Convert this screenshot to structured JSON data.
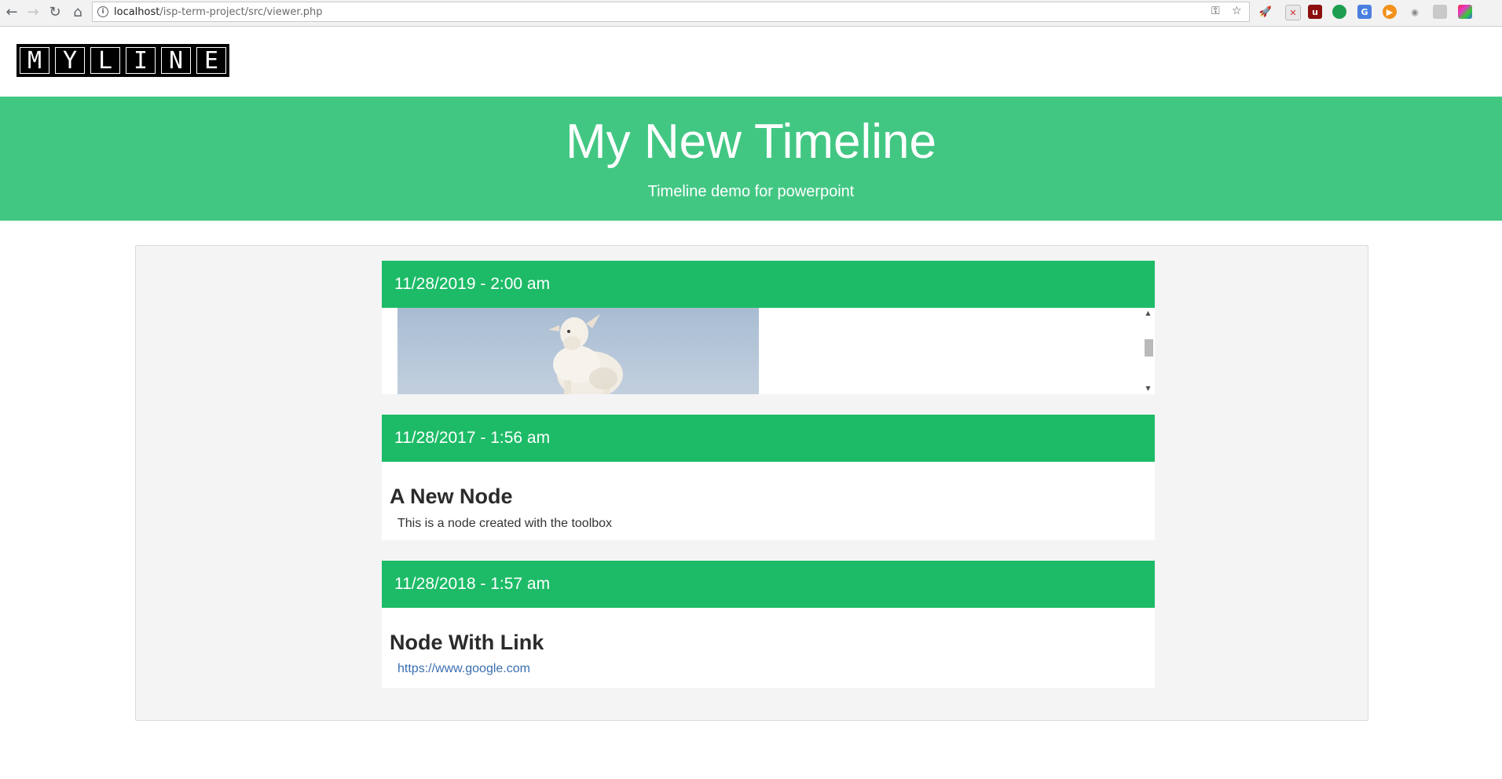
{
  "browser": {
    "url_host": "localhost",
    "url_path": "/isp-term-project/src/viewer.php",
    "back_icon": "←",
    "forward_icon": "→",
    "reload_icon": "↻",
    "home_icon": "⌂"
  },
  "site": {
    "logo_letters": [
      "M",
      "Y",
      "L",
      "I",
      "N",
      "E"
    ],
    "title": "My New Timeline",
    "subtitle": "Timeline demo for powerpoint"
  },
  "colors": {
    "hero": "#42c783",
    "node_header": "#1dbb67",
    "link": "#3a6eb0"
  },
  "nodes": [
    {
      "date": "11/28/2019 - 2:00 am",
      "type": "image",
      "image_icon": "lamb-photo"
    },
    {
      "date": "11/28/2017 - 1:56 am",
      "type": "text",
      "title": "A New Node",
      "body": "This is a node created with the toolbox"
    },
    {
      "date": "11/28/2018 - 1:57 am",
      "type": "link",
      "title": "Node With Link",
      "link": "https://www.google.com"
    }
  ]
}
